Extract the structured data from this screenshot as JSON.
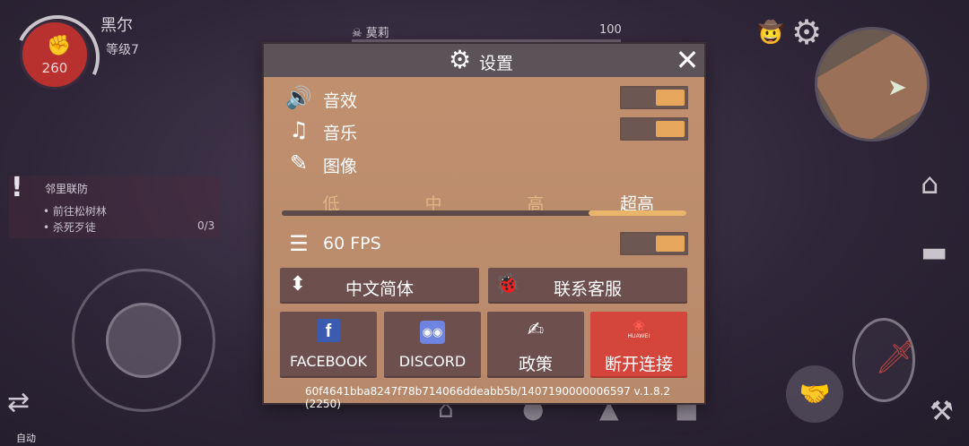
{
  "player": {
    "name": "黑尔",
    "level": "等级7",
    "hp": "260"
  },
  "target": {
    "name": "莫莉",
    "hp": "100"
  },
  "quest": {
    "title": "邻里联防",
    "steps": [
      "• 前往松树林",
      "• 杀死歹徒"
    ],
    "count": "0/3"
  },
  "hud": {
    "auto_label": "自动"
  },
  "settings": {
    "title": "设置",
    "close": "✕",
    "sound_label": "音效",
    "music_label": "音乐",
    "graphics_label": "图像",
    "quality": {
      "options": [
        "低",
        "中",
        "高",
        "超高"
      ],
      "selected_index": 3
    },
    "fps_label": "60 FPS",
    "toggles": {
      "sound": true,
      "music": true,
      "fps60": true
    },
    "language_button": "中文简体",
    "support_button": "联系客服",
    "facebook_button": "FACEBOOK",
    "discord_button": "DISCORD",
    "policy_button": "政策",
    "disconnect_button": "断开连接",
    "huawei_brand": "HUAWEI",
    "version_text": "60f4641bba8247f78b714066ddeabb5b/1407190000006597  v.1.8.2 (2250)"
  },
  "colors": {
    "panel": "#bb8c6c",
    "header": "#5c5358",
    "button": "#6d4f4d",
    "accent": "#e6a75c",
    "danger": "#d4463c"
  }
}
